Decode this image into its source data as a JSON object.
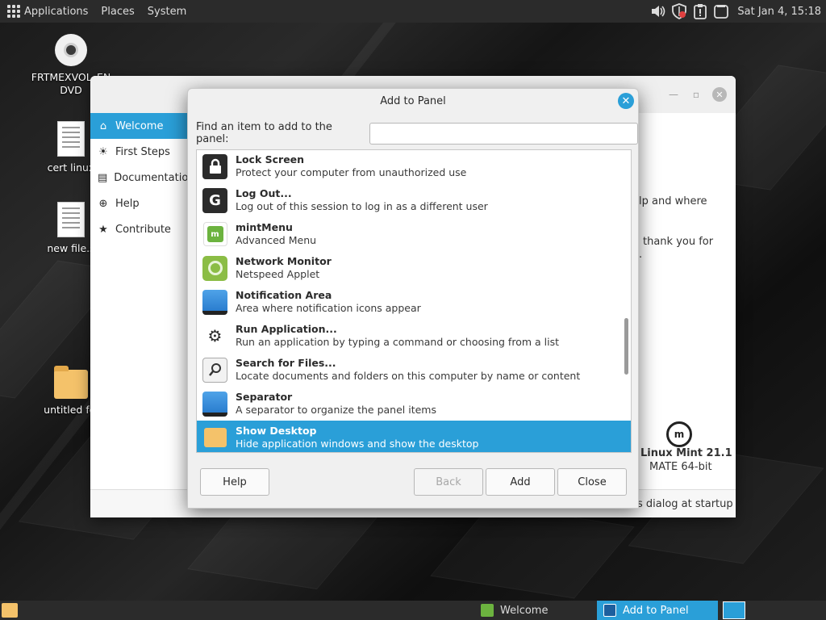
{
  "top_panel": {
    "menus": [
      "Applications",
      "Places",
      "System"
    ],
    "clock": "Sat Jan 4, 15:18",
    "tray_icons": [
      "volume-icon",
      "shield-icon",
      "update-icon",
      "window-icon"
    ]
  },
  "desktop": {
    "icons": [
      {
        "label": "FRTMEXVOL_EN\nDVD",
        "type": "dvd-icon"
      },
      {
        "label": "cert linux",
        "type": "document-icon"
      },
      {
        "label": "new file.s",
        "type": "document-icon"
      },
      {
        "label": "untitled fol",
        "type": "folder-icon"
      }
    ]
  },
  "welcome_window": {
    "sidebar": [
      {
        "label": "Welcome",
        "icon": "home-icon",
        "active": true
      },
      {
        "label": "First Steps",
        "icon": "lightbulb-icon",
        "active": false
      },
      {
        "label": "Documentation",
        "icon": "book-icon",
        "active": false
      },
      {
        "label": "Help",
        "icon": "lifebuoy-icon",
        "active": false
      },
      {
        "label": "Contribute",
        "icon": "star-icon",
        "active": false
      }
    ],
    "content_fragment_1": "lp and where",
    "content_fragment_2": "thank you for",
    "content_fragment_3": ".",
    "edition_name": "Linux Mint 21.1",
    "edition_desc": "MATE 64-bit",
    "footer_text": "s dialog at startup"
  },
  "dialog": {
    "title": "Add to Panel",
    "find_label": "Find an item to add to the panel:",
    "find_value": "",
    "items": [
      {
        "name": "Lock Screen",
        "desc": "Protect your computer from unauthorized use",
        "icon": "lock-icon"
      },
      {
        "name": "Log Out...",
        "desc": "Log out of this session to log in as a different user",
        "icon": "logout-icon"
      },
      {
        "name": "mintMenu",
        "desc": "Advanced Menu",
        "icon": "mint-menu-icon"
      },
      {
        "name": "Network Monitor",
        "desc": "Netspeed Applet",
        "icon": "network-monitor-icon"
      },
      {
        "name": "Notification Area",
        "desc": "Area where notification icons appear",
        "icon": "notification-area-icon"
      },
      {
        "name": "Run Application...",
        "desc": "Run an application by typing a command or choosing from a list",
        "icon": "gears-icon"
      },
      {
        "name": "Search for Files...",
        "desc": "Locate documents and folders on this computer by name or content",
        "icon": "search-icon"
      },
      {
        "name": "Separator",
        "desc": "A separator to organize the panel items",
        "icon": "separator-icon"
      },
      {
        "name": "Show Desktop",
        "desc": "Hide application windows and show the desktop",
        "icon": "show-desktop-icon",
        "selected": true
      }
    ],
    "buttons": {
      "help": "Help",
      "back": "Back",
      "add": "Add",
      "close": "Close"
    }
  },
  "bottom_panel": {
    "tasks": [
      {
        "label": "Welcome",
        "active": false
      },
      {
        "label": "Add to Panel",
        "active": true
      }
    ]
  },
  "colors": {
    "accent": "#2a9fd8",
    "panel": "#2b2b2b",
    "mint_green": "#6cb33f"
  }
}
